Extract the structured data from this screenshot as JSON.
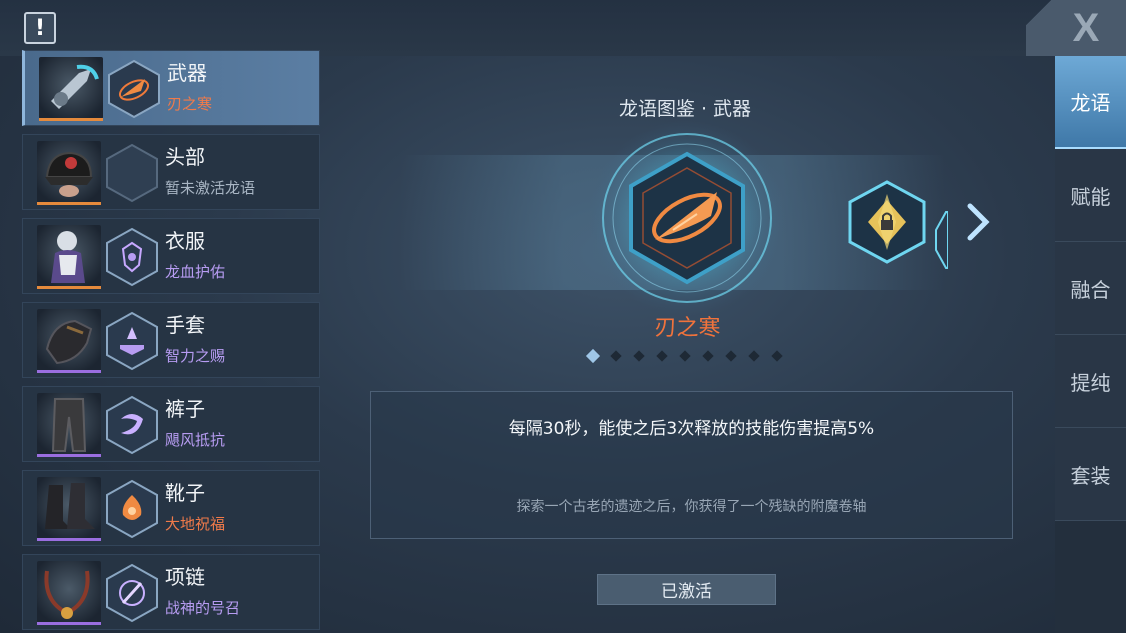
{
  "header": {
    "alert_symbol": "!",
    "close_symbol": "X"
  },
  "equipment": [
    {
      "name": "武器",
      "dragon_word": "刃之寒",
      "sub_color": "orange",
      "rarity": "orange",
      "icon": "weapon-icon",
      "selected": true
    },
    {
      "name": "头部",
      "dragon_word": "暂未激活龙语",
      "sub_color": "gray",
      "rarity": "orange",
      "icon": "helmet-icon",
      "selected": false
    },
    {
      "name": "衣服",
      "dragon_word": "龙血护佑",
      "sub_color": "purple",
      "rarity": "orange",
      "icon": "armor-icon",
      "selected": false
    },
    {
      "name": "手套",
      "dragon_word": "智力之赐",
      "sub_color": "purple",
      "rarity": "purple",
      "icon": "gloves-icon",
      "selected": false
    },
    {
      "name": "裤子",
      "dragon_word": "飓风抵抗",
      "sub_color": "purple",
      "rarity": "purple",
      "icon": "pants-icon",
      "selected": false
    },
    {
      "name": "靴子",
      "dragon_word": "大地祝福",
      "sub_color": "orange",
      "rarity": "purple",
      "icon": "boots-icon",
      "selected": false
    },
    {
      "name": "项链",
      "dragon_word": "战神的号召",
      "sub_color": "purple",
      "rarity": "purple",
      "icon": "necklace-icon",
      "selected": false
    }
  ],
  "codex": {
    "title": "龙语图鉴 · 武器",
    "current_name": "刃之寒",
    "page_total": 9,
    "page_current": 1,
    "effect": "每隔30秒，能使之后3次释放的技能伤害提高5%",
    "lore": "探索一个古老的遗迹之后，你获得了一个残缺的附魔卷轴",
    "status_button": "已激活"
  },
  "tabs": [
    {
      "label": "龙语",
      "active": true
    },
    {
      "label": "赋能",
      "active": false
    },
    {
      "label": "融合",
      "active": false
    },
    {
      "label": "提纯",
      "active": false
    },
    {
      "label": "套装",
      "active": false
    }
  ],
  "colors": {
    "accent_orange": "#f0733c",
    "accent_purple": "#b79cf2",
    "tab_active": "#4f8dbf"
  }
}
